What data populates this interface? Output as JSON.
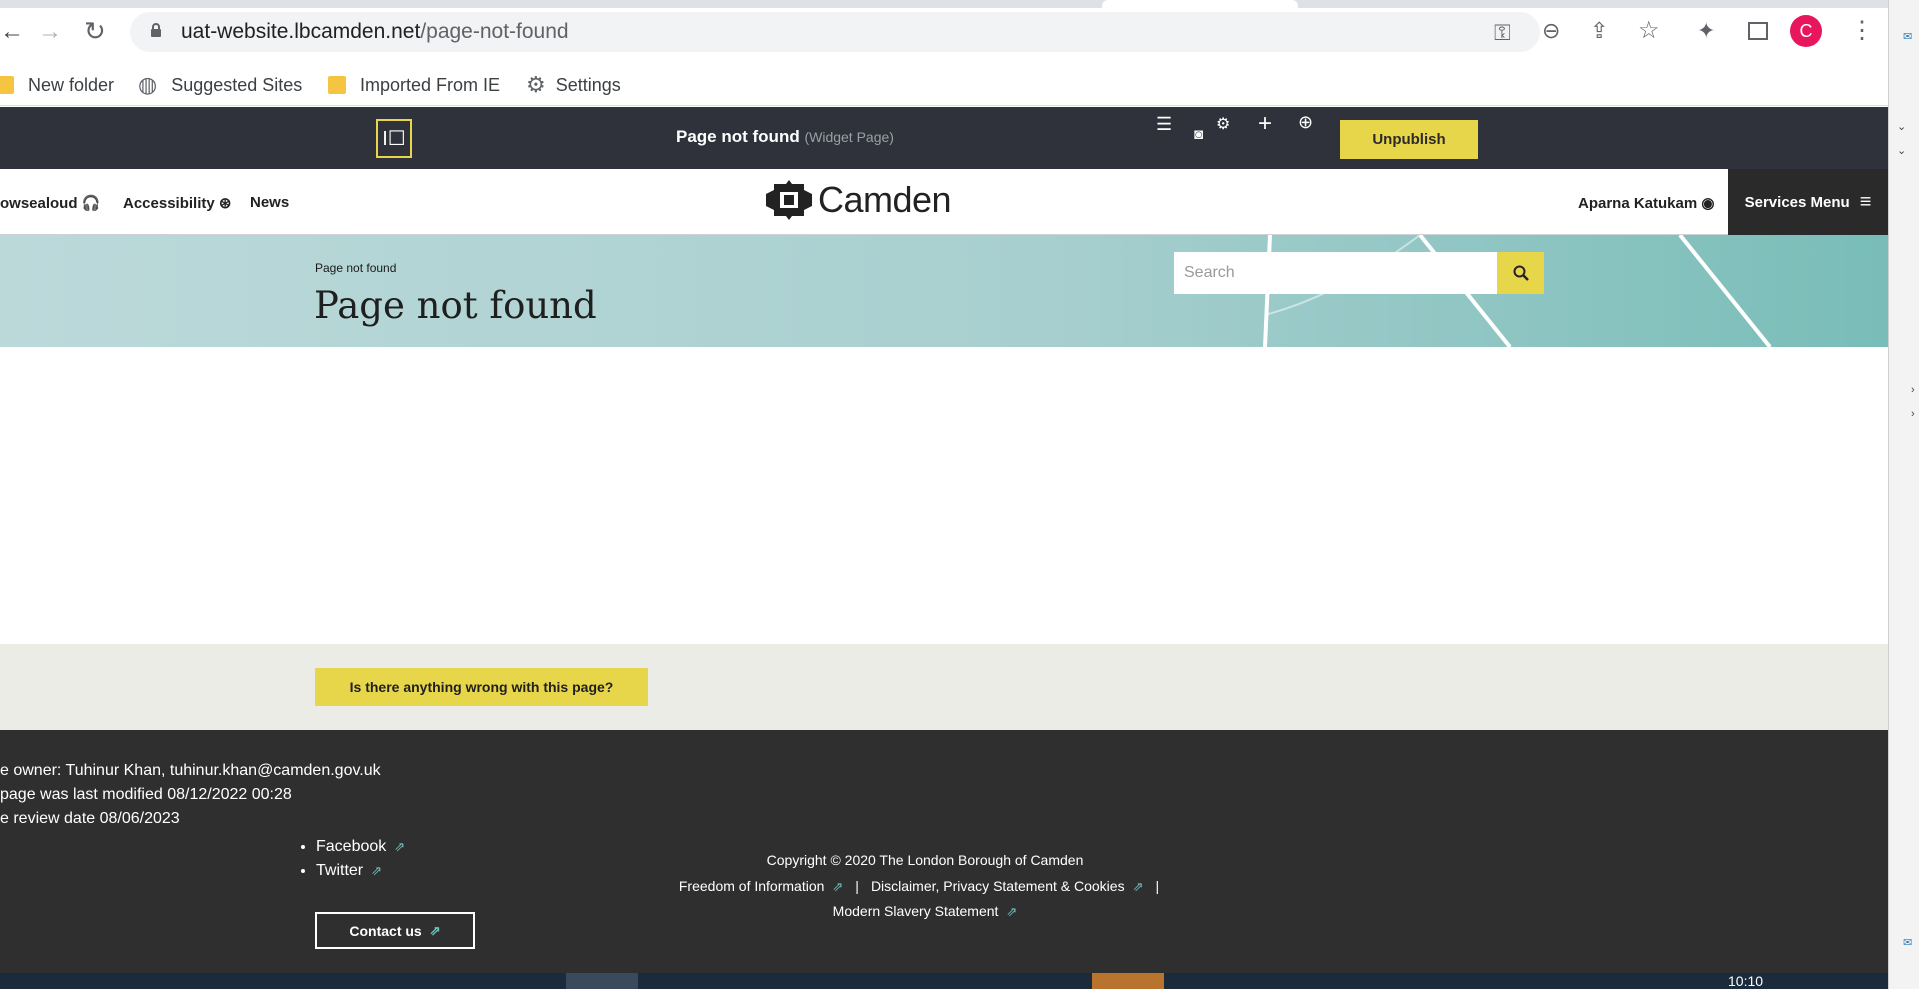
{
  "browser": {
    "url_host": "uat-website.lbcamden.net",
    "url_path": "/page-not-found",
    "profile_initial": "C",
    "accent_color": "#e8175d"
  },
  "bookmarks": [
    {
      "label": "New folder",
      "icon": "folder-icon"
    },
    {
      "label": "Suggested Sites",
      "icon": "globe-icon"
    },
    {
      "label": "Imported From IE",
      "icon": "folder-icon"
    },
    {
      "label": "Settings",
      "icon": "gear-icon"
    }
  ],
  "admin": {
    "toggle_label": "I☐",
    "title": "Page not found",
    "subtitle": "(Widget Page)",
    "unpublish_label": "Unpublish"
  },
  "header": {
    "browsealoud": "owsealoud",
    "accessibility": "Accessibility",
    "news": "News",
    "logo_text": "Camden",
    "user_name": "Aparna Katukam",
    "services_menu": "Services Menu"
  },
  "banner": {
    "breadcrumb": "Page not found",
    "title": "Page not found",
    "search_placeholder": "Search"
  },
  "feedback": {
    "button_label": "Is there anything wrong with this page?"
  },
  "footer": {
    "owner": "e owner: Tuhinur Khan, tuhinur.khan@camden.gov.uk",
    "modified": " page was last modified 08/12/2022 00:28",
    "review": "e review date 08/06/2023",
    "social": [
      "Facebook",
      "Twitter"
    ],
    "contact_label": "Contact us",
    "copyright": "Copyright © 2020 The London Borough of Camden",
    "links": [
      "Freedom of Information",
      "Disclaimer, Privacy Statement & Cookies",
      "Modern Slavery Statement"
    ]
  },
  "taskbar": {
    "clock": "10:10"
  },
  "colors": {
    "admin_bar": "#2f323a",
    "camden_yellow": "#e8d64a",
    "banner_teal": "#a8cfcf",
    "footer": "#2f2f2f"
  }
}
